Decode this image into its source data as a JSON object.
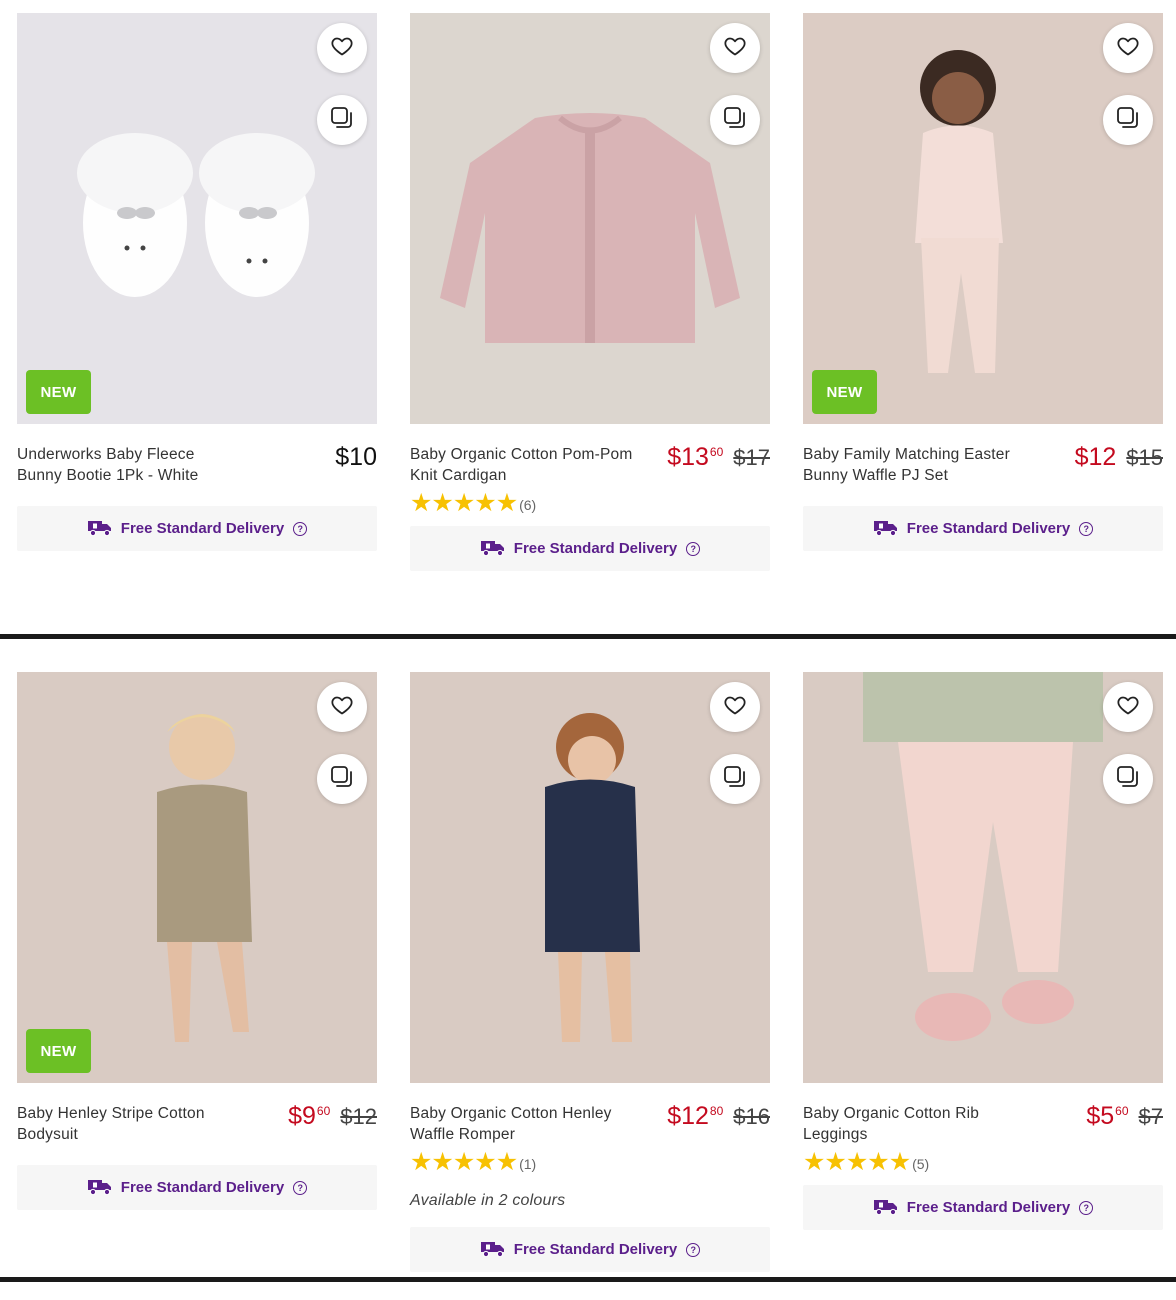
{
  "products": [
    {
      "title": "Underworks Baby Fleece Bunny Bootie 1Pk - White",
      "price_dollars": "$10",
      "price_cents": "",
      "was_price": "",
      "badge": "NEW",
      "rating_stars": 0,
      "rating_count": "",
      "availability": "",
      "delivery_label": "Free Standard Delivery",
      "image_bg": "#e5e3e8"
    },
    {
      "title": "Baby Organic Cotton Pom-Pom Knit Cardigan",
      "price_dollars": "$13",
      "price_cents": "60",
      "was_price": "$17",
      "badge": "",
      "rating_stars": 5,
      "rating_count": "(6)",
      "availability": "",
      "delivery_label": "Free Standard Delivery",
      "image_bg": "#dcd6cf"
    },
    {
      "title": "Baby Family Matching Easter Bunny Waffle PJ Set",
      "price_dollars": "$12",
      "price_cents": "",
      "was_price": "$15",
      "badge": "NEW",
      "rating_stars": 0,
      "rating_count": "",
      "availability": "",
      "delivery_label": "Free Standard Delivery",
      "image_bg": "#dcccc4"
    },
    {
      "title": "Baby Henley Stripe Cotton Bodysuit",
      "price_dollars": "$9",
      "price_cents": "60",
      "was_price": "$12",
      "badge": "NEW",
      "rating_stars": 0,
      "rating_count": "",
      "availability": "",
      "delivery_label": "Free Standard Delivery",
      "image_bg": "#d9cbc3"
    },
    {
      "title": "Baby Organic Cotton Henley Waffle Romper",
      "price_dollars": "$12",
      "price_cents": "80",
      "was_price": "$16",
      "badge": "",
      "rating_stars": 5,
      "rating_count": "(1)",
      "availability": "Available in 2 colours",
      "delivery_label": "Free Standard Delivery",
      "image_bg": "#d9cbc3"
    },
    {
      "title": "Baby Organic Cotton Rib Leggings",
      "price_dollars": "$5",
      "price_cents": "60",
      "was_price": "$7",
      "badge": "",
      "rating_stars": 5,
      "rating_count": "(5)",
      "availability": "",
      "delivery_label": "Free Standard Delivery",
      "image_bg": "#d9cbc3"
    }
  ],
  "colors": {
    "sale_price": "#c40a1f",
    "badge_new": "#6cc025",
    "delivery_text": "#5b1f8b",
    "star": "#f7c102"
  },
  "icons": {
    "wishlist": "heart-icon",
    "quick_view": "quick-view-icon",
    "delivery": "delivery-truck-icon",
    "help": "help-icon"
  }
}
